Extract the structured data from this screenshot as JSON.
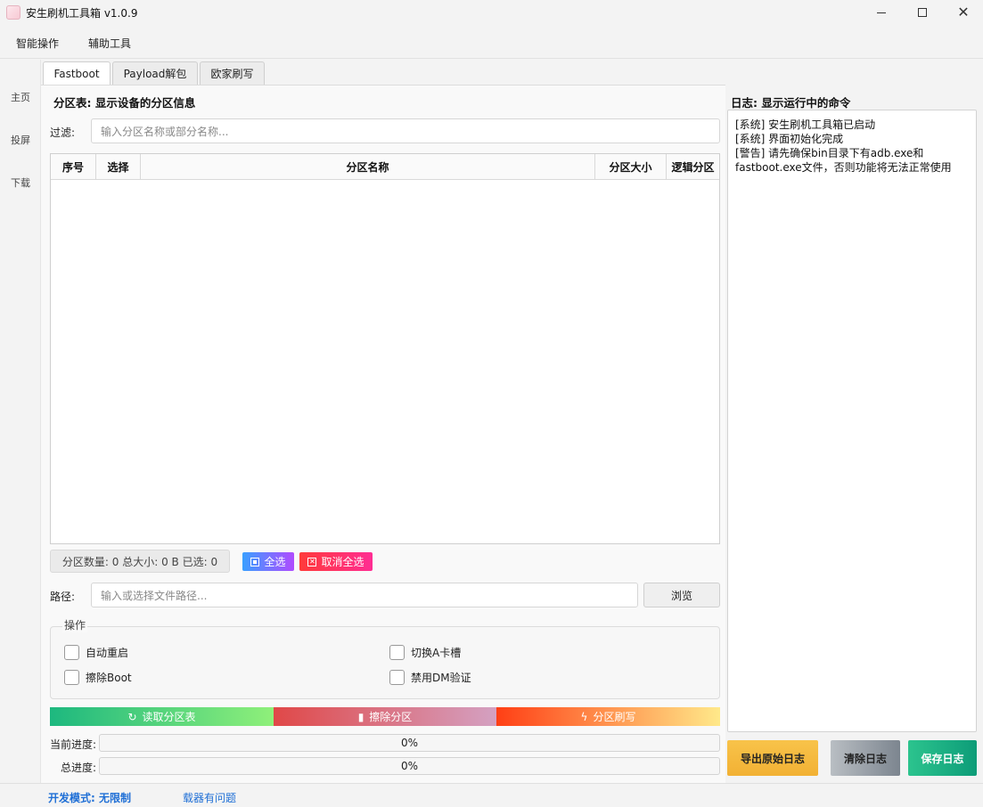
{
  "window": {
    "title": "安生刷机工具箱 v1.0.9"
  },
  "menu": {
    "items": [
      "智能操作",
      "辅助工具"
    ]
  },
  "nav": {
    "items": [
      "主页",
      "投屏",
      "下载"
    ]
  },
  "tabs": [
    "Fastboot",
    "Payload解包",
    "欧家刷写"
  ],
  "partition": {
    "title": "分区表: 显示设备的分区信息",
    "filter_label": "过滤:",
    "filter_placeholder": "输入分区名称或部分名称...",
    "columns": [
      "序号",
      "选择",
      "分区名称",
      "分区大小",
      "逻辑分区"
    ],
    "stats": "分区数量: 0  总大小: 0 B  已选: 0",
    "select_all": "全选",
    "unselect_all": "取消全选"
  },
  "path": {
    "label": "路径:",
    "placeholder": "输入或选择文件路径...",
    "browse": "浏览"
  },
  "ops": {
    "legend": "操作",
    "checkboxes": [
      "自动重启",
      "擦除Boot",
      "切换A卡槽",
      "禁用DM验证"
    ]
  },
  "actions": {
    "read": "读取分区表",
    "erase": "擦除分区",
    "flash": "分区刷写"
  },
  "progress": {
    "current_label": "当前进度:",
    "current_value": "0%",
    "total_label": "总进度:",
    "total_value": "0%"
  },
  "log": {
    "title": "日志: 显示运行中的命令",
    "lines": [
      "[系统] 安生刷机工具箱已启动",
      "[系统] 界面初始化完成",
      "[警告] 请先确保bin目录下有adb.exe和fastboot.exe文件，否则功能将无法正常使用"
    ],
    "export": "导出原始日志",
    "clear": "清除日志",
    "save": "保存日志"
  },
  "status": {
    "dev_mode": "开发模式: 无限制",
    "issue": "载器有问题"
  },
  "colors": {
    "accent_blue": "#1f6fd6"
  }
}
